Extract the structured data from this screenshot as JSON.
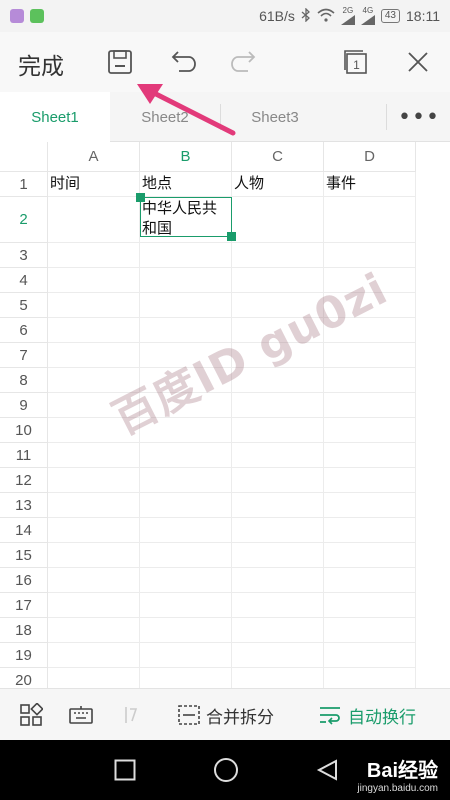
{
  "status_bar": {
    "speed": "61B/s",
    "network": "2G",
    "network2": "4G",
    "battery": "43",
    "time": "18:11"
  },
  "toolbar": {
    "done_label": "完成",
    "icons": [
      "save-icon",
      "undo-icon",
      "redo-icon",
      "window-switch-icon",
      "close-icon"
    ],
    "window_count": "1"
  },
  "sheet_tabs": {
    "tabs": [
      {
        "label": "Sheet1",
        "active": true
      },
      {
        "label": "Sheet2",
        "active": false
      },
      {
        "label": "Sheet3",
        "active": false
      }
    ],
    "more_label": "•••"
  },
  "grid": {
    "columns": [
      "A",
      "B",
      "C",
      "D"
    ],
    "active_column": "B",
    "rows": [
      "1",
      "2",
      "3",
      "4",
      "5",
      "6",
      "7",
      "8",
      "9",
      "10",
      "11",
      "12",
      "13",
      "14",
      "15",
      "16",
      "17",
      "18",
      "19",
      "20"
    ],
    "active_row": "2",
    "cells": {
      "A1": "时间",
      "B1": "地点",
      "C1": "人物",
      "D1": "事件",
      "B2": "中华人民共和国"
    }
  },
  "watermark": "百度ID gu0zi",
  "bottom_toolbar": {
    "merge_split_label": "合并拆分",
    "auto_wrap_label": "自动换行"
  },
  "nav_bar": {
    "brand": "Bai经验",
    "brand_sub": "jingyan.baidu.com"
  },
  "colors": {
    "accent": "#1a9c6b",
    "annotation_arrow": "#e23a7a"
  }
}
